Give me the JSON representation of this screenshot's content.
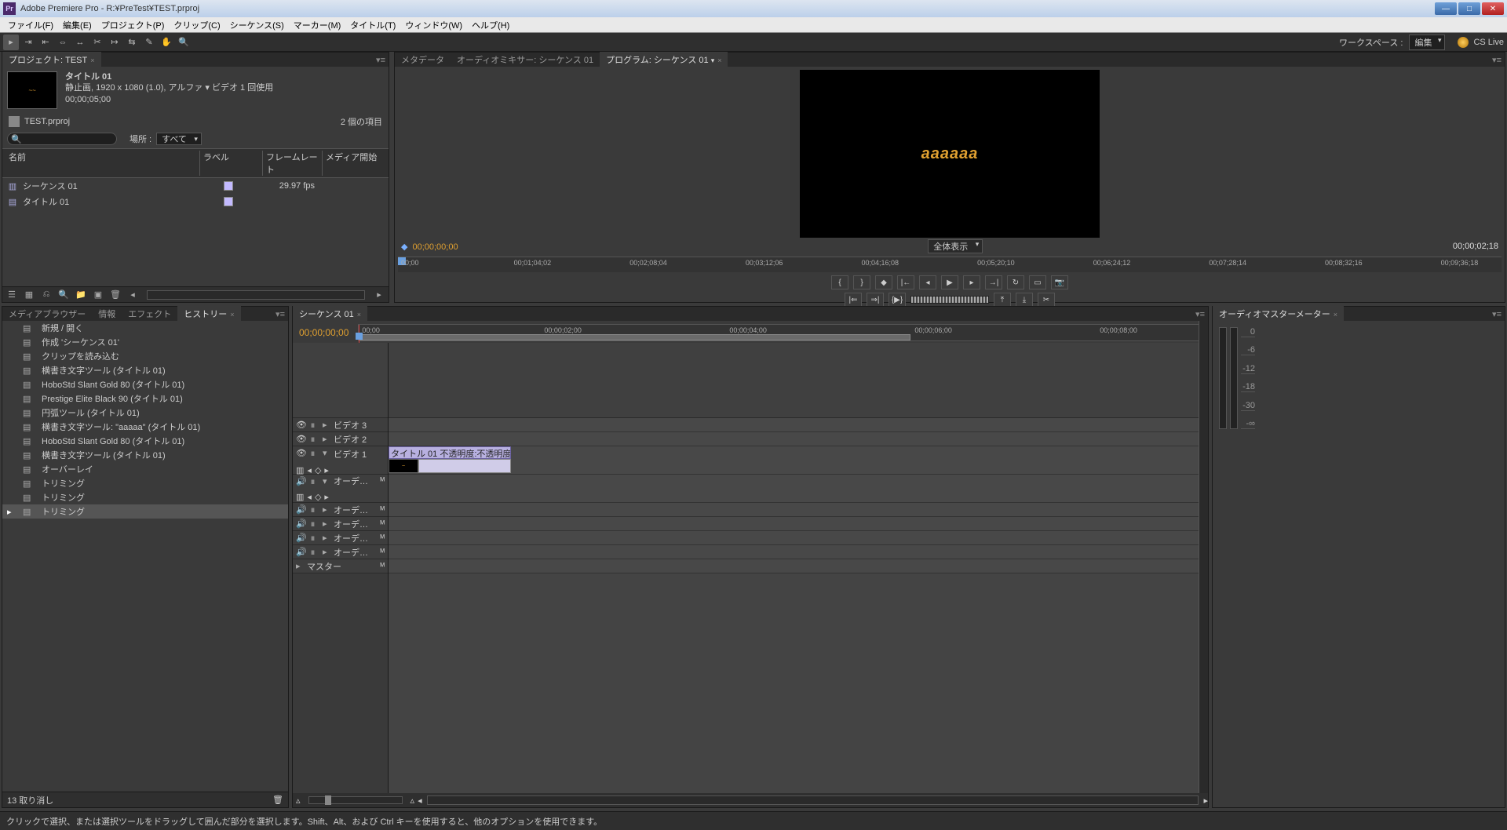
{
  "window": {
    "title": "Adobe Premiere Pro - R:¥PreTest¥TEST.prproj"
  },
  "menu": [
    "ファイル(F)",
    "編集(E)",
    "プロジェクト(P)",
    "クリップ(C)",
    "シーケンス(S)",
    "マーカー(M)",
    "タイトル(T)",
    "ウィンドウ(W)",
    "ヘルプ(H)"
  ],
  "toolbar": {
    "workspace_label": "ワークスペース :",
    "workspace_value": "編集",
    "cslive": "CS Live"
  },
  "project": {
    "tab": "プロジェクト: TEST",
    "clip": {
      "title": "タイトル 01",
      "meta1": "静止画, 1920 x 1080 (1.0), アルファ ▾ ビデオ 1 回使用",
      "meta2": "00;00;05;00"
    },
    "filename": "TEST.prproj",
    "item_count": "2 個の項目",
    "search_placeholder": "",
    "location_label": "場所 :",
    "location_value": "すべて",
    "cols": {
      "name": "名前",
      "label": "ラベル",
      "fps": "フレームレート",
      "start": "メディア開始"
    },
    "rows": [
      {
        "name": "シーケンス 01",
        "fps": "29.97 fps"
      },
      {
        "name": "タイトル 01",
        "fps": ""
      }
    ]
  },
  "program": {
    "tabs": {
      "meta": "メタデータ",
      "mixer": "オーディオミキサー: シーケンス 01",
      "program": "プログラム: シーケンス 01"
    },
    "preview_text": "aaaaaa",
    "tc_left": "00;00;00;00",
    "fit": "全体表示",
    "tc_right": "00;00;02;18",
    "ruler": [
      "00;00",
      "00;01;04;02",
      "00;02;08;04",
      "00;03;12;06",
      "00;04;16;08",
      "00;05;20;10",
      "00;06;24;12",
      "00;07;28;14",
      "00;08;32;16",
      "00;09;36;18"
    ]
  },
  "history": {
    "tabs": {
      "media": "メディアブラウザー",
      "info": "情報",
      "effects": "エフェクト",
      "history": "ヒストリー"
    },
    "items": [
      "新規 / 開く",
      "作成 'シーケンス 01'",
      "クリップを読み込む",
      "横書き文字ツール (タイトル 01)",
      "HoboStd Slant Gold 80 (タイトル 01)",
      "Prestige Elite Black 90 (タイトル 01)",
      "円弧ツール (タイトル 01)",
      "横書き文字ツール: \"aaaaa\" (タイトル 01)",
      "HoboStd Slant Gold 80 (タイトル 01)",
      "横書き文字ツール (タイトル 01)",
      "オーバーレイ",
      "トリミング",
      "トリミング",
      "トリミング"
    ],
    "undo": "13 取り消し"
  },
  "timeline": {
    "tab": "シーケンス 01",
    "tc": "00;00;00;00",
    "ruler": [
      "00;00",
      "00;00;02;00",
      "00;00;04;00",
      "00;00;06;00",
      "00;00;08;00"
    ],
    "tracks": {
      "video3": "ビデオ 3",
      "video2": "ビデオ 2",
      "video1": "ビデオ 1",
      "audio_short": "オーデ…",
      "master": "マスター"
    },
    "clip": {
      "label": "タイトル 01 不透明度:不透明度 ▾"
    }
  },
  "audiometer": {
    "tab": "オーディオマスターメーター",
    "scale": [
      "0",
      "-6",
      "-12",
      "-18",
      "-30",
      "-∞"
    ]
  },
  "status": "クリックで選択、または選択ツールをドラッグして囲んだ部分を選択します。Shift、Alt、および Ctrl キーを使用すると、他のオプションを使用できます。"
}
